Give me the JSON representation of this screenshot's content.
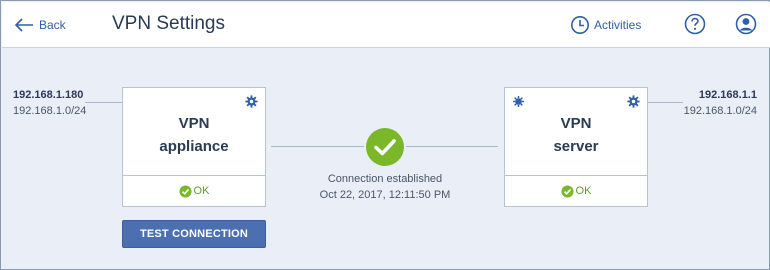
{
  "header": {
    "back_label": "Back",
    "title": "VPN Settings",
    "activities_label": "Activities",
    "help_icon": "help-circle-icon",
    "user_icon": "user-account-icon"
  },
  "local": {
    "ip": "192.168.1.180",
    "subnet": "192.168.1.0/24"
  },
  "remote": {
    "ip": "192.168.1.1",
    "subnet": "192.168.1.0/24"
  },
  "appliance_card": {
    "name": "VPN\nappliance",
    "status": "OK"
  },
  "server_card": {
    "name": "VPN\nserver",
    "status": "OK"
  },
  "connection": {
    "status_text": "Connection established",
    "timestamp": "Oct 22, 2017, 12:11:50 PM"
  },
  "actions": {
    "test_connection_label": "TEST CONNECTION"
  },
  "colors": {
    "accent": "#2f5fa7",
    "success": "#7ab829",
    "button": "#4b6fb0",
    "background": "#e9eef7"
  }
}
